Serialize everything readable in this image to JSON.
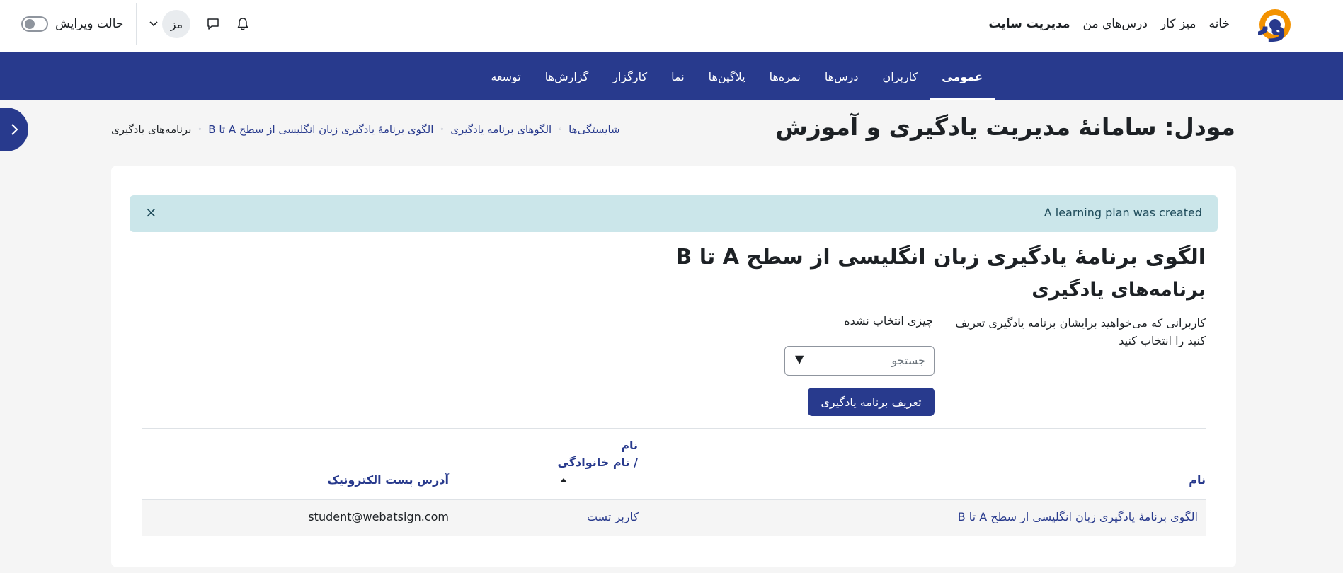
{
  "topbar": {
    "brand_colors": {
      "orange": "#f39200",
      "navy": "#283a8d"
    },
    "nav_links": [
      "خانه",
      "میز کار",
      "درس‌های من",
      "مدیریت سایت"
    ],
    "avatar_initials": "مز",
    "edit_mode_label": "حالت ویرایش",
    "icons": [
      "bell-icon",
      "chat-icon",
      "chevron-down-icon"
    ]
  },
  "secondary_nav": {
    "active_color": "#283a8d",
    "items": [
      "عمومی",
      "کاربران",
      "درس‌ها",
      "نمره‌ها",
      "پلاگین‌ها",
      "نما",
      "کارگزار",
      "گزارش‌ها",
      "توسعه"
    ]
  },
  "page": {
    "title": "مودل: سامانهٔ مدیریت یادگیری و آموزش"
  },
  "breadcrumb": [
    "شایستگی‌ها",
    "الگوهای برنامه یادگیری",
    "الگوی برنامهٔ یادگیری زبان انگلیسی از سطح A تا B",
    "برنامه‌های یادگیری"
  ],
  "alert": {
    "message": "A learning plan was created",
    "close": "×"
  },
  "content": {
    "heading": "الگوی برنامهٔ یادگیری زبان انگلیسی از سطح A تا B",
    "subheading": "برنامه‌های یادگیری",
    "form_label": "کاربرانی که می‌خواهید برایشان برنامه یادگیری تعریف کنید را انتخاب کنید",
    "nothing_selected": "چیزی انتخاب نشده",
    "search_placeholder": "جستجو",
    "dropdown_arrow": "▼",
    "submit_label": "تعریف برنامه یادگیری"
  },
  "table": {
    "headers": {
      "name": "نام",
      "first_name": "نام",
      "last_name": "/ نام خانوادگی",
      "email": "آدرس پست الکترونیک"
    },
    "rows": [
      {
        "plan": "الگوی برنامهٔ یادگیری زبان انگلیسی از سطح A تا B",
        "user": "کاربر تست",
        "email": "student@webatsign.com"
      }
    ]
  }
}
